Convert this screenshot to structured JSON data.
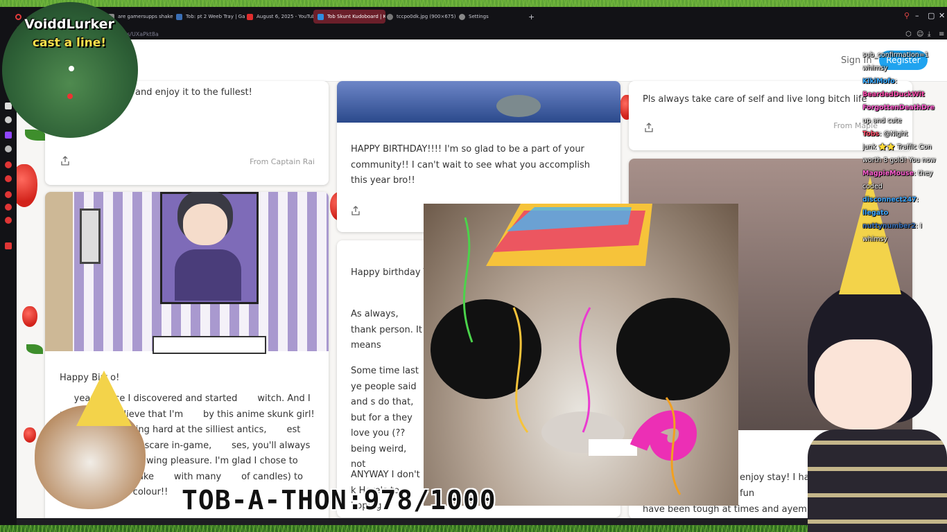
{
  "tabs": [
    {
      "label": "are gamersupps shakers",
      "color": "#888888"
    },
    {
      "label": "Tob: pt 2 Weeb Tray | Ga",
      "color": "#3a6fb5"
    },
    {
      "label": "August 6, 2025 - YouTub",
      "color": "#e02d2d"
    },
    {
      "label": "Tob Skunt Kudoboard | K",
      "color": "#2e8de0",
      "active": true
    },
    {
      "label": "tccpo0dk.jpg (900×675)",
      "color": "#777777"
    },
    {
      "label": "Settings",
      "color": "#888888"
    }
  ],
  "url_fragment": "ds/UXaPkt8a",
  "header": {
    "signin": "Sign In",
    "register": "Register"
  },
  "overlay": {
    "map_title": "VoiddLurker",
    "map_subtitle": "cast a line!",
    "counter": "TOB-A-THON:978/1000"
  },
  "cards": {
    "c1": {
      "text": "and enjoy it to the fullest!",
      "from": "From Captain Rai"
    },
    "c2": {
      "text": "HAPPY BIRTHDAY!!!! I'm so glad to be a part of your community!! I can't wait to see what you accomplish this year bro!!"
    },
    "c3": {
      "text": "Pls always take care of self and live long bitch life",
      "from": "From Maple"
    },
    "c4": {
      "p1": "Happy Birt     o!",
      "p2": "     years since I discovered and started       witch. And I really can't believe that I'm       by this anime skunk girl! What's       laughing hard at the silliest antics,       est frustration or jumpscare in-game,       ses, you'll always remain a party       wing pleasure. I'm glad I chose to enjoy       thday cake       with many       of candles) to add crunch and colour!!"
    },
    "c5": {
      "p1": "Happy birthday T",
      "p2": "As always, thank person. It means",
      "p3": "Some time last ye people said and s do that, but for a they love you (?? being weird, not",
      "p4": "ANYWAY I don't k Here's to hoping"
    },
    "c6": {
      "p1": "enjoy stay! I have be always good fun",
      "p2": "have been tough at times and ayem pro"
    }
  },
  "chat": {
    "lines": [
      {
        "user": "",
        "msg": "sub_confirmation=1",
        "color": "#ffffff"
      },
      {
        "user": "",
        "msg": "whimsy",
        "color": "#ffffff"
      },
      {
        "user": "KikiMofo",
        "msg": ":",
        "color": "#35a8ff"
      },
      {
        "user": "BeardedDuckWit",
        "msg": "",
        "color": "#ff4fb0"
      },
      {
        "user": "ForgottenDeathDre",
        "msg": "",
        "color": "#ff5fd0"
      },
      {
        "user": "",
        "msg": "up and cute",
        "color": "#ffffff"
      },
      {
        "user": "Tobs",
        "msg": ": @Night",
        "color": "#ff4f6a"
      },
      {
        "user": "",
        "msg": "junk ⭐⭐ Traffic Con",
        "color": "#ffffff"
      },
      {
        "user": "",
        "msg": "worth 8 gold! You now",
        "color": "#ffffff"
      },
      {
        "user": "",
        "msg": "",
        "color": "#ffffff"
      },
      {
        "user": "MagpieMouse",
        "msg": ": they",
        "color": "#ff5fd0"
      },
      {
        "user": "",
        "msg": "coded",
        "color": "#ffffff"
      },
      {
        "user": "disconnect247",
        "msg": ":",
        "color": "#3ea8ff"
      },
      {
        "user": "llegato",
        "msg": "",
        "color": "#3ea8ff"
      },
      {
        "user": "nuttynumber2",
        "msg": ": I",
        "color": "#3a6fb5"
      },
      {
        "user": "",
        "msg": "whimsy",
        "color": "#ffffff"
      }
    ]
  }
}
